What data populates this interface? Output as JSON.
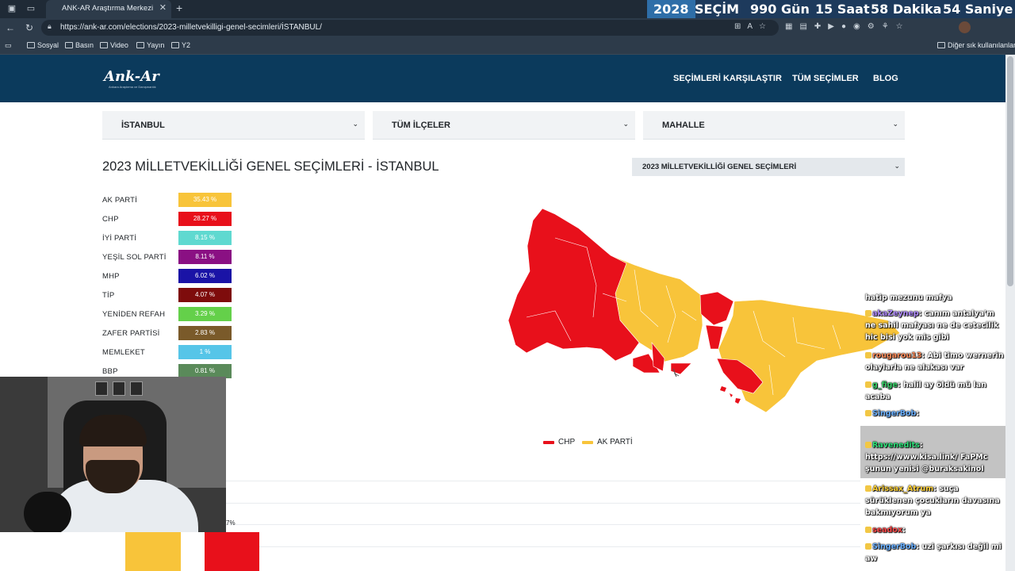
{
  "browser": {
    "tab_title": "ANK-AR Araştırma Merkezi",
    "url": "https://ank-ar.com/elections/2023-milletvekilligi-genel-secimleri/İSTANBUL/",
    "bookmarks": [
      "Sosyal",
      "Basın",
      "Video",
      "Yayın",
      "Y2"
    ],
    "other_bookmarks": "Diğer sık kullanılanlar"
  },
  "countdown": {
    "year": "2028",
    "label": "SEÇİM",
    "days": "990 Gün",
    "hours": "15 Saat",
    "minutes": "58 Dakika",
    "seconds": "54 Saniye"
  },
  "header": {
    "logo": "Ank-Ar",
    "logo_sub": "Ankara Araştırma ve Danışmanlık",
    "nav": [
      "SEÇİMLERİ KARŞILAŞTIR",
      "TÜM SEÇİMLER",
      "BLOG"
    ]
  },
  "filters": {
    "province": "İSTANBUL",
    "district": "TÜM İLÇELER",
    "neighborhood": "MAHALLE"
  },
  "page_title": "2023 MİLLETVEKİLLİĞİ GENEL SEÇİMLERİ - İSTANBUL",
  "election_select": "2023 MİLLETVEKİLLİĞİ GENEL SEÇİMLERİ",
  "results": [
    {
      "party": "AK PARTİ",
      "pct": "35.43 %",
      "color": "#f8c43a"
    },
    {
      "party": "CHP",
      "pct": "28.27 %",
      "color": "#e8101b"
    },
    {
      "party": "İYİ PARTİ",
      "pct": "8.15 %",
      "color": "#5fd9d0"
    },
    {
      "party": "YEŞİL SOL PARTİ",
      "pct": "8.11 %",
      "color": "#8a1083"
    },
    {
      "party": "MHP",
      "pct": "6.02 %",
      "color": "#1a13a6"
    },
    {
      "party": "TİP",
      "pct": "4.07 %",
      "color": "#7e0c0c"
    },
    {
      "party": "YENİDEN REFAH",
      "pct": "3.29 %",
      "color": "#64d04a"
    },
    {
      "party": "ZAFER PARTİSİ",
      "pct": "2.83 %",
      "color": "#7a5a2a"
    },
    {
      "party": "MEMLEKET",
      "pct": "1 %",
      "color": "#56c5e8"
    },
    {
      "party": "BBP",
      "pct": "0.81 %",
      "color": "#5a8a5a"
    }
  ],
  "map_legend": [
    {
      "label": "CHP",
      "color": "#e8101b"
    },
    {
      "label": "AK PARTİ",
      "color": "#f8c43a"
    }
  ],
  "bottom_pct_fragment": "7%",
  "chat": [
    {
      "user": "",
      "text": "hatip mezunu mafya",
      "user_color": "#ffffff"
    },
    {
      "user": "akaZeynep",
      "text": ": canım antalya'm ne sahil mafyası ne de cetecilik hic bisi yok mis gibi",
      "user_color": "#b18cff"
    },
    {
      "user": "rougarou13",
      "text": ": Abi timo wernerin olaylarla ne alakası var",
      "user_color": "#ff8c5a"
    },
    {
      "user": "g_fige",
      "text": ": halil ay öldü mü lan acaba",
      "user_color": "#3ad06a"
    },
    {
      "user": "SingerBob",
      "text": ":",
      "user_color": "#6ab0ff"
    },
    {
      "user": "Ravenedits",
      "text": ": https://www.kisa.link/ FaPMc şunun yenisi @buraksakinol",
      "user_color": "#2ee07a"
    },
    {
      "user": "Arissax_Atrum",
      "text": ": suça sürüklenen çocukların davasına bakmıyorum ya",
      "user_color": "#ffd23a"
    },
    {
      "user": "seadox",
      "text": ":",
      "user_color": "#ff4a4a"
    },
    {
      "user": "SingerBob",
      "text": ": uzi şarkısı değil mi aw",
      "user_color": "#6ab0ff"
    }
  ],
  "icons": [
    "workspaces-icon",
    "tab-actions-icon",
    "back-icon",
    "refresh-icon",
    "lock-icon",
    "star-icon",
    "folder-icon",
    "copilot-icon"
  ]
}
